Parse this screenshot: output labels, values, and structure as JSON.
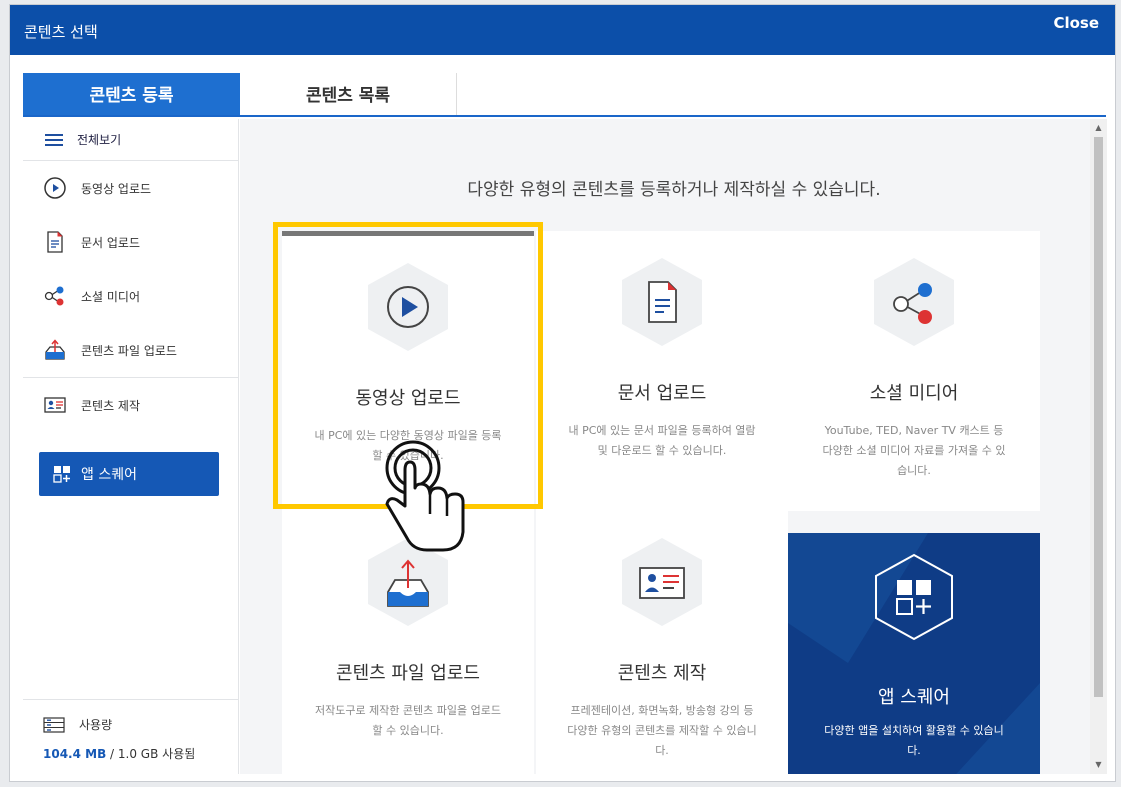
{
  "window": {
    "title": "콘텐츠 선택",
    "close_label": "Close"
  },
  "tabs": [
    {
      "label": "콘텐츠 등록",
      "active": true
    },
    {
      "label": "콘텐츠 목록",
      "active": false
    }
  ],
  "sidebar": {
    "all_label": "전체보기",
    "items": [
      {
        "label": "동영상 업로드",
        "icon": "play-circle-icon"
      },
      {
        "label": "문서 업로드",
        "icon": "document-icon"
      },
      {
        "label": "소셜 미디어",
        "icon": "share-icon"
      },
      {
        "label": "콘텐츠 파일 업로드",
        "icon": "upload-tray-icon"
      },
      {
        "label": "콘텐츠 제작",
        "icon": "id-card-icon"
      }
    ],
    "app_square_label": "앱 스퀘어",
    "usage": {
      "label": "사용량",
      "used": "104.4 MB",
      "rest": " / 1.0 GB 사용됨"
    }
  },
  "main": {
    "headline": "다양한 유형의 콘텐츠를 등록하거나 제작하실 수 있습니다.",
    "cards": [
      {
        "title": "동영상 업로드",
        "desc": "내 PC에 있는 다양한 동영상 파일을 등록할 수 있습니다.",
        "icon": "play-circle-icon"
      },
      {
        "title": "문서 업로드",
        "desc": "내 PC에 있는 문서 파일을 등록하여 열람 및 다운로드 할 수 있습니다.",
        "icon": "document-icon"
      },
      {
        "title": "소셜 미디어",
        "desc": "YouTube, TED, Naver TV 캐스트 등 다양한 소셜 미디어 자료를 가져올 수 있습니다.",
        "icon": "share-icon"
      },
      {
        "title": "콘텐츠 파일 업로드",
        "desc": "저작도구로 제작한 콘텐츠 파일을 업로드 할 수 있습니다.",
        "icon": "upload-tray-icon"
      },
      {
        "title": "콘텐츠 제작",
        "desc": "프레젠테이션, 화면녹화, 방송형 강의 등 다양한 유형의 콘텐츠를 제작할 수 있습니다.",
        "icon": "id-card-icon"
      },
      {
        "title": "앱 스퀘어",
        "desc": "다양한 앱을 설치하여 활용할 수 있습니다.",
        "icon": "app-grid-icon"
      }
    ]
  },
  "colors": {
    "titlebar": "#0c4fa9",
    "active_tab": "#1e6fd0",
    "highlight": "#ffc800",
    "dark_card": "#0f3c86"
  }
}
